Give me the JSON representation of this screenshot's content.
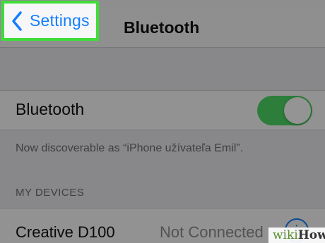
{
  "nav": {
    "back_label": "Settings",
    "title": "Bluetooth"
  },
  "bluetooth": {
    "label": "Bluetooth",
    "enabled": true,
    "discoverable_text": "Now discoverable as “iPhone užívateľa Emil”."
  },
  "devices": {
    "section_title": "MY DEVICES",
    "items": [
      {
        "name": "Creative D100",
        "status": "Not Connected"
      }
    ]
  },
  "watermark": {
    "part1": "wiki",
    "part2": "How"
  },
  "colors": {
    "accent": "#147efb",
    "toggle_on": "#4cd964",
    "highlight": "#3fdc3a"
  },
  "icons": [
    "chevron-left-icon",
    "info-icon"
  ]
}
